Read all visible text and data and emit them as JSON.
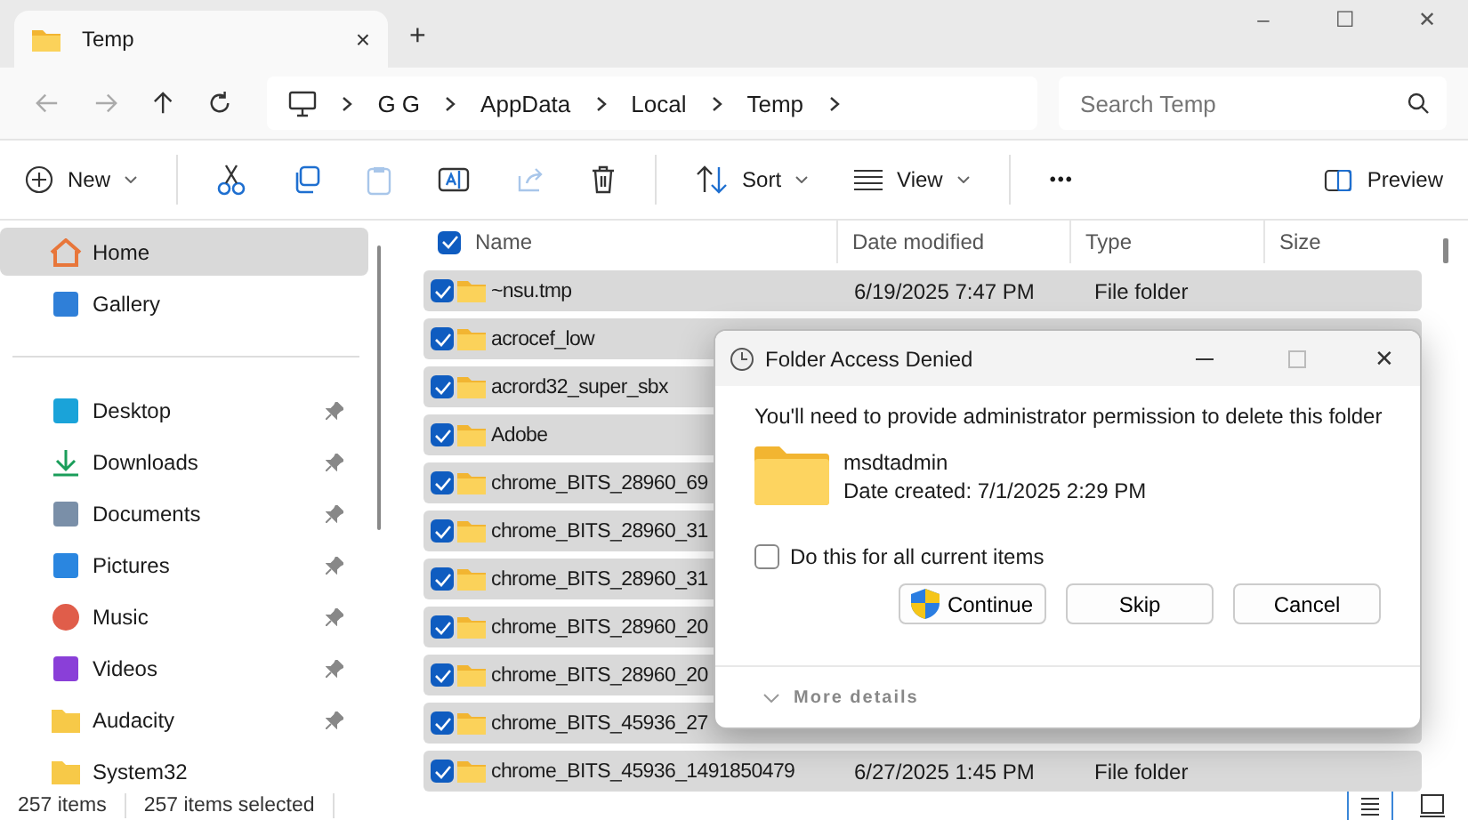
{
  "tab": {
    "title": "Temp",
    "close": "×",
    "new": "+"
  },
  "window_controls": {
    "minimize": "–",
    "maximize": "☐",
    "close": "✕"
  },
  "breadcrumb": [
    "G G",
    "AppData",
    "Local",
    "Temp"
  ],
  "search": {
    "placeholder": "Search Temp"
  },
  "toolbar": {
    "new": "New",
    "sort": "Sort",
    "view": "View",
    "more": "•••",
    "preview": "Preview"
  },
  "sidebar": {
    "items": [
      {
        "label": "Home",
        "selected": true,
        "pinned": false
      },
      {
        "label": "Gallery",
        "selected": false,
        "pinned": false
      },
      {
        "kind": "divider"
      },
      {
        "label": "Desktop",
        "selected": false,
        "pinned": true
      },
      {
        "label": "Downloads",
        "selected": false,
        "pinned": true
      },
      {
        "label": "Documents",
        "selected": false,
        "pinned": true
      },
      {
        "label": "Pictures",
        "selected": false,
        "pinned": true
      },
      {
        "label": "Music",
        "selected": false,
        "pinned": true
      },
      {
        "label": "Videos",
        "selected": false,
        "pinned": true
      },
      {
        "label": "Audacity",
        "selected": false,
        "pinned": true
      },
      {
        "label": "System32",
        "selected": false,
        "pinned": false
      }
    ]
  },
  "table": {
    "all_checked": true,
    "columns": [
      "Name",
      "Date modified",
      "Type",
      "Size"
    ],
    "rows": [
      {
        "name": "~nsu.tmp",
        "date": "6/19/2025 7:47 PM",
        "type": "File folder",
        "checked": true
      },
      {
        "name": "acrocef_low",
        "checked": true
      },
      {
        "name": "acrord32_super_sbx",
        "checked": true
      },
      {
        "name": "Adobe",
        "checked": true
      },
      {
        "name": "chrome_BITS_28960_69",
        "checked": true
      },
      {
        "name": "chrome_BITS_28960_31",
        "checked": true
      },
      {
        "name": "chrome_BITS_28960_31",
        "checked": true
      },
      {
        "name": "chrome_BITS_28960_20",
        "checked": true
      },
      {
        "name": "chrome_BITS_28960_20",
        "checked": true
      },
      {
        "name": "chrome_BITS_45936_27",
        "checked": true
      },
      {
        "name": "chrome_BITS_45936_1491850479",
        "date": "6/27/2025 1:45 PM",
        "type": "File folder",
        "checked": true
      }
    ]
  },
  "status_bar": {
    "count": "257 items",
    "selected": "257 items selected"
  },
  "dialog": {
    "title": "Folder Access Denied",
    "message": "You'll need to provide administrator permission to delete this folder",
    "folder_name": "msdtadmin",
    "date_created": "Date created: 7/1/2025 2:29 PM",
    "checkbox": {
      "label": "Do this for all current items",
      "checked": false
    },
    "buttons": [
      "Continue",
      "Skip",
      "Cancel"
    ],
    "more": "More details",
    "close": "✕"
  }
}
